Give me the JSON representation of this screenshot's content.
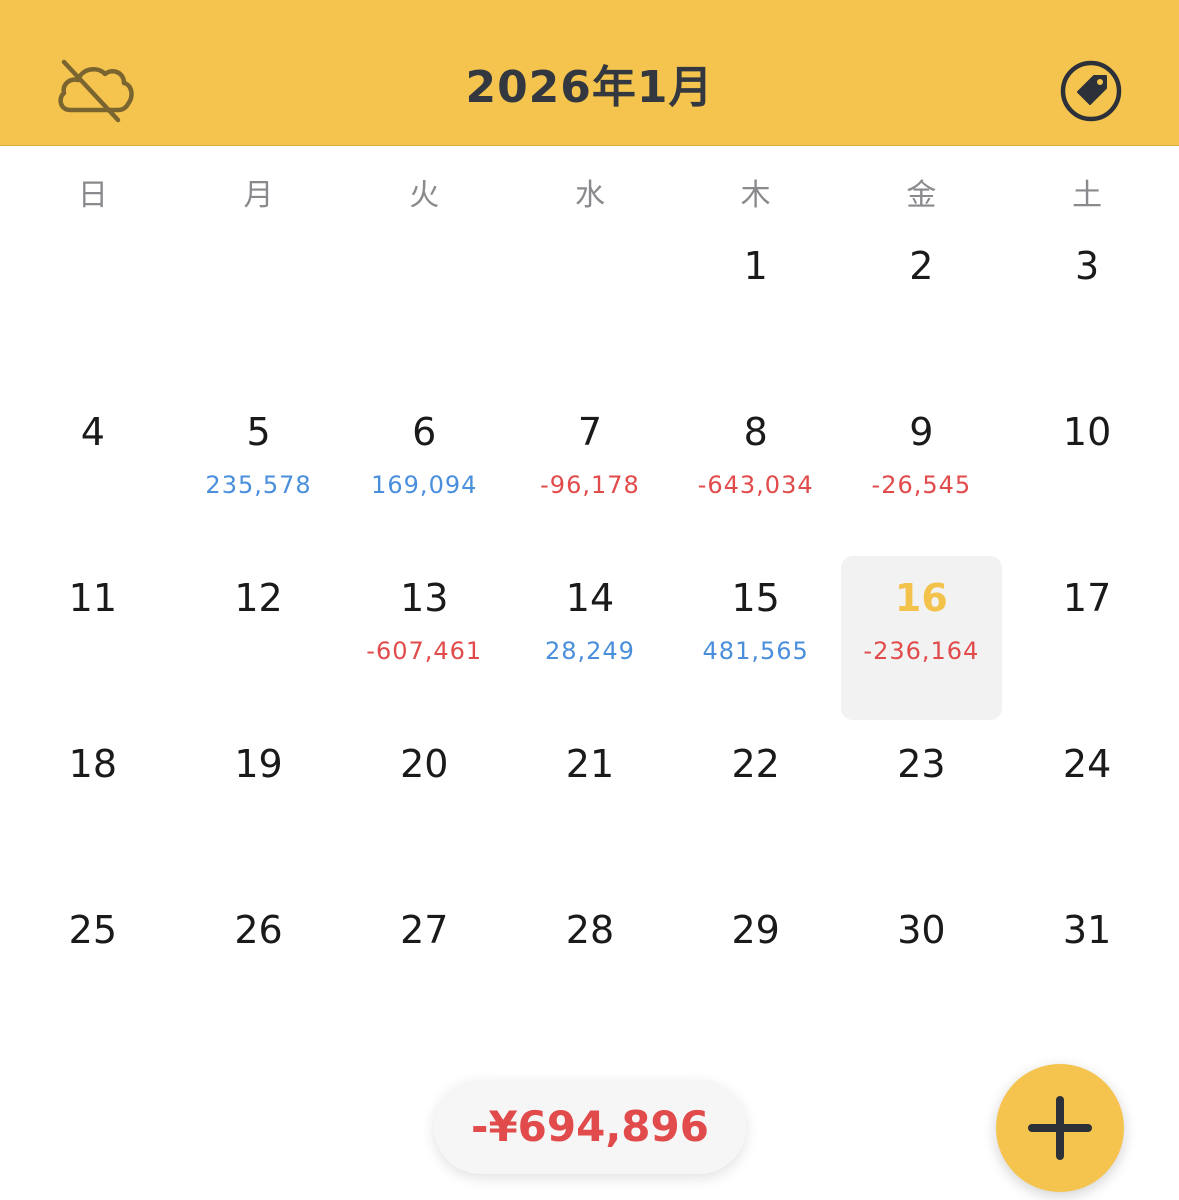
{
  "header": {
    "title": "2026年1月",
    "cloud_icon": "cloud-off-icon",
    "tag_icon": "tag-icon"
  },
  "weekdays": [
    "日",
    "月",
    "火",
    "水",
    "木",
    "金",
    "土"
  ],
  "days": [
    {
      "day": "",
      "amount": ""
    },
    {
      "day": "",
      "amount": ""
    },
    {
      "day": "",
      "amount": ""
    },
    {
      "day": "",
      "amount": ""
    },
    {
      "day": "1",
      "amount": ""
    },
    {
      "day": "2",
      "amount": ""
    },
    {
      "day": "3",
      "amount": ""
    },
    {
      "day": "4",
      "amount": ""
    },
    {
      "day": "5",
      "amount": "235,578"
    },
    {
      "day": "6",
      "amount": "169,094"
    },
    {
      "day": "7",
      "amount": "-96,178"
    },
    {
      "day": "8",
      "amount": "-643,034"
    },
    {
      "day": "9",
      "amount": "-26,545"
    },
    {
      "day": "10",
      "amount": ""
    },
    {
      "day": "11",
      "amount": ""
    },
    {
      "day": "12",
      "amount": ""
    },
    {
      "day": "13",
      "amount": "-607,461"
    },
    {
      "day": "14",
      "amount": "28,249"
    },
    {
      "day": "15",
      "amount": "481,565"
    },
    {
      "day": "16",
      "amount": "-236,164",
      "today": true
    },
    {
      "day": "17",
      "amount": ""
    },
    {
      "day": "18",
      "amount": ""
    },
    {
      "day": "19",
      "amount": ""
    },
    {
      "day": "20",
      "amount": ""
    },
    {
      "day": "21",
      "amount": ""
    },
    {
      "day": "22",
      "amount": ""
    },
    {
      "day": "23",
      "amount": ""
    },
    {
      "day": "24",
      "amount": ""
    },
    {
      "day": "25",
      "amount": ""
    },
    {
      "day": "26",
      "amount": ""
    },
    {
      "day": "27",
      "amount": ""
    },
    {
      "day": "28",
      "amount": ""
    },
    {
      "day": "29",
      "amount": ""
    },
    {
      "day": "30",
      "amount": ""
    },
    {
      "day": "31",
      "amount": ""
    }
  ],
  "total": "-¥694,896",
  "colors": {
    "accent": "#f5c44e",
    "positive": "#4a8fdc",
    "negative": "#e14b4b",
    "today": "#f2c24a"
  },
  "fab_icon": "plus-icon"
}
